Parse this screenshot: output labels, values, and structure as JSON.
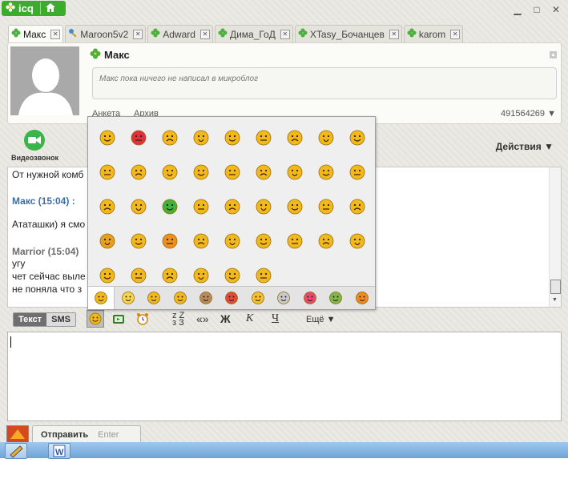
{
  "app": {
    "logo_text": "icq"
  },
  "tabs": [
    {
      "label": "Макс",
      "active": true
    },
    {
      "label": "Maroon5v2",
      "active": false
    },
    {
      "label": "Adward",
      "active": false
    },
    {
      "label": "Дима_ГоД",
      "active": false
    },
    {
      "label": "XTasy_Бочанцев",
      "active": false
    },
    {
      "label": "karom",
      "active": false
    }
  ],
  "contact": {
    "name": "Макс",
    "microblog_placeholder": "Макс пока ничего не написал в микроблог",
    "link_profile": "Анкета",
    "link_archive": "Архив",
    "uin": "491564269"
  },
  "toolbar": {
    "video_label": "Видеозвонок",
    "actions_label": "Действия"
  },
  "chat": {
    "lines": [
      {
        "text": "От нужной комб"
      },
      {
        "sender": "Макс (15:04) :"
      },
      {
        "text": "Ататашки) я смо"
      },
      {
        "sender2": "Marrior (15:04)"
      },
      {
        "text": "угу"
      },
      {
        "text": "чет сейчас выле"
      },
      {
        "text": "не поняла что з"
      }
    ]
  },
  "formatbar": {
    "mode_text": "Текст",
    "mode_sms": "SMS",
    "transl": "«»",
    "bold": "Ж",
    "italic": "К",
    "underline": "Ч",
    "more": "Ещё"
  },
  "send": {
    "label": "Отправить",
    "hint": "Enter"
  },
  "colors": {
    "accent": "#3aae2a",
    "sender": "#3d6ea8",
    "smiley": "#f2b81c"
  },
  "emoticon_picker": {
    "rows": 5,
    "cols": 9,
    "count": 42,
    "category_tabs": 11,
    "selected_tab": 0
  }
}
